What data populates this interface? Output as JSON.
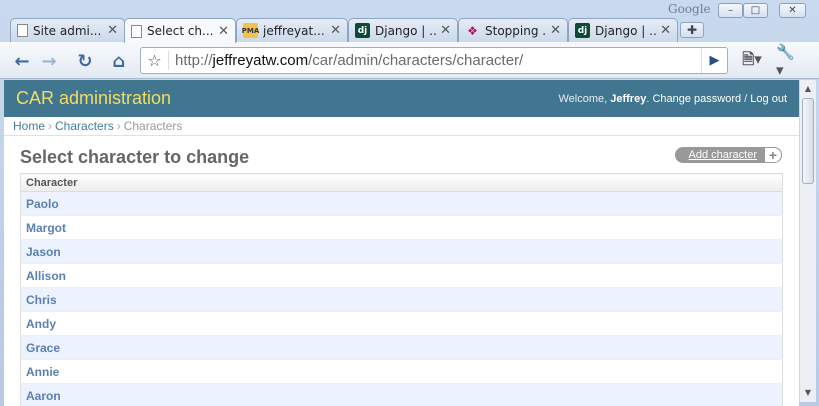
{
  "browser": {
    "brand": "Google",
    "tabs": [
      {
        "label": "Site admi...",
        "favicon": "page-icon",
        "active": false
      },
      {
        "label": "Select ch...",
        "favicon": "page-icon",
        "active": true
      },
      {
        "label": "jeffreyat...",
        "favicon": "phpmyadmin-icon",
        "active": false
      },
      {
        "label": "Django | ...",
        "favicon": "django-icon",
        "active": false
      },
      {
        "label": "Stopping ...",
        "favicon": "feather-icon",
        "active": false
      },
      {
        "label": "Django | ...",
        "favicon": "django-icon",
        "active": false
      }
    ],
    "address": {
      "scheme": "http://",
      "host": "jeffreyatw.com",
      "path": "/car/admin/characters/character/"
    }
  },
  "header": {
    "title": "CAR administration",
    "welcome": "Welcome,",
    "user": "Jeffrey",
    "change_password": "Change password",
    "separator": "/",
    "logout": "Log out"
  },
  "breadcrumbs": [
    "Home",
    "Characters",
    "Characters"
  ],
  "page": {
    "title": "Select character to change",
    "add_button": "Add character"
  },
  "table": {
    "column": "Character",
    "rows": [
      "Paolo",
      "Margot",
      "Jason",
      "Allison",
      "Chris",
      "Andy",
      "Grace",
      "Annie",
      "Aaron"
    ]
  }
}
